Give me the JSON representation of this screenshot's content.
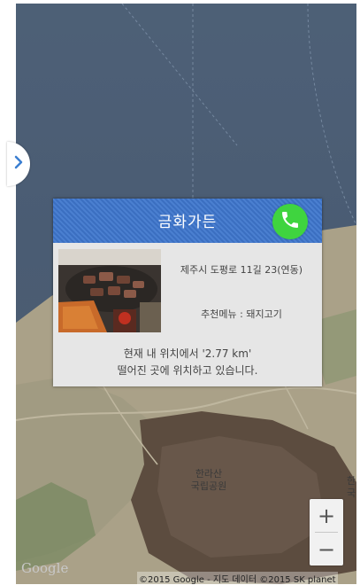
{
  "popup": {
    "title": "금화가든",
    "address": "제주시 도평로 11길 23(연동)",
    "menu": "추천메뉴 : 돼지고기",
    "distance_line1": "현재 내 위치에서 '2.77 km'",
    "distance_line2": "떨어진 곳에 위치하고 있습니다."
  },
  "map": {
    "park_line1": "한라산",
    "park_line2": "국립공원",
    "park_edge_line1": "한",
    "park_edge_line2": "국",
    "google_logo": "Google",
    "copyright": "©2015 Google - 지도 데이터 ©2015 SK planet"
  },
  "zoom": {
    "plus": "+",
    "minus": "−"
  },
  "icons": {
    "side_tab": "chevron-right-icon",
    "call": "phone-icon"
  },
  "colors": {
    "header_blue": "#3b6fc1",
    "call_green": "#3fd43f",
    "sea": "#5a6f86"
  }
}
